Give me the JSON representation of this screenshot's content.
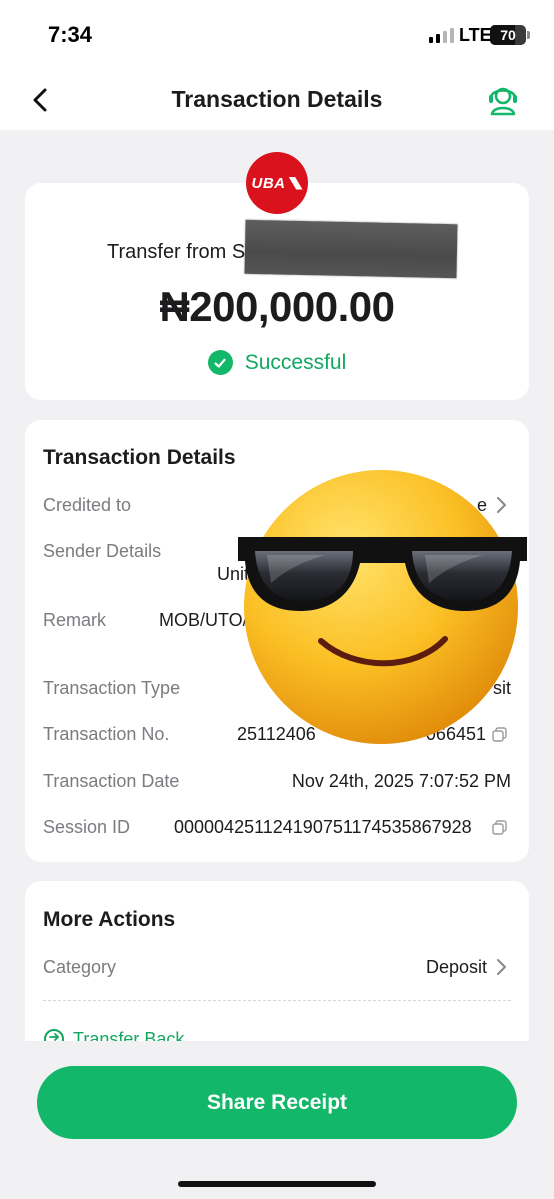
{
  "status_bar": {
    "time": "7:34",
    "network": "LTE",
    "battery": "70",
    "battery_level": 0.7
  },
  "nav": {
    "title": "Transaction Details",
    "back_icon": "chevron-left-icon",
    "support_icon": "customer-support-icon"
  },
  "summary": {
    "bank_logo_text": "UBA",
    "transfer_from": "Transfer from S",
    "amount": "₦200,000.00",
    "status": "Successful"
  },
  "details": {
    "title": "Transaction Details",
    "credited_to": {
      "label": "Credited to",
      "value": "e"
    },
    "sender_details": {
      "label": "Sender Details",
      "value": "Unit"
    },
    "remark": {
      "label": "Remark",
      "value": "MOB/UTO/"
    },
    "transaction_type": {
      "label": "Transaction Type",
      "value": "sit"
    },
    "transaction_no": {
      "label": "Transaction No.",
      "value": "25112406",
      "value_end": "066451"
    },
    "transaction_date": {
      "label": "Transaction Date",
      "value": "Nov 24th, 2025 7:07:52 PM"
    },
    "session_id": {
      "label": "Session ID",
      "value": "000004251124190751174535867928"
    }
  },
  "more_actions": {
    "title": "More Actions",
    "category": {
      "label": "Category",
      "value": "Deposit"
    },
    "transfer_back": "Transfer Back"
  },
  "footer": {
    "share_button": "Share Receipt"
  },
  "colors": {
    "accent": "#12b76a",
    "background": "#f1f1f4",
    "bank_red": "#d9121e"
  }
}
